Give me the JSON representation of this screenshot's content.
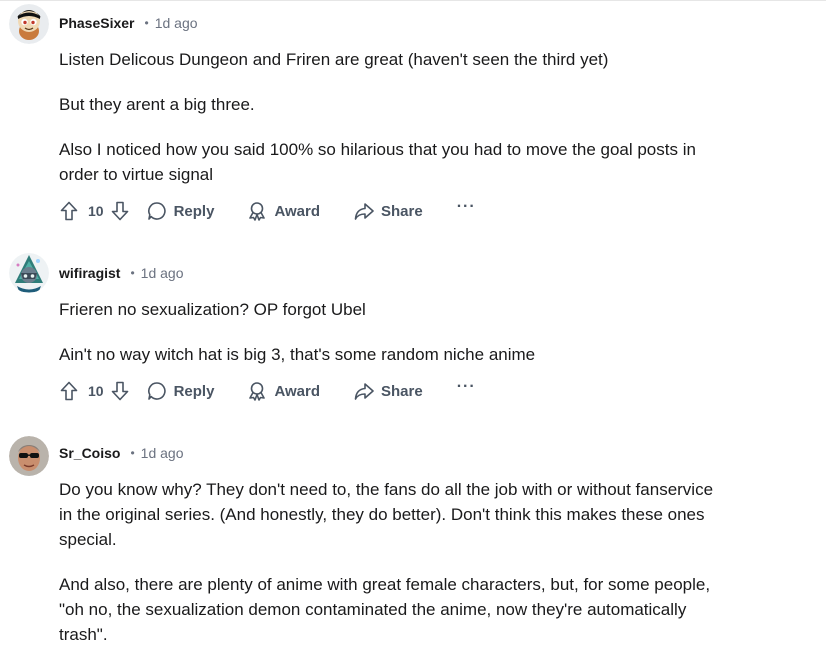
{
  "comments": [
    {
      "username": "PhaseSixer",
      "separator": "•",
      "time": "1d ago",
      "paragraphs": [
        "Listen Delicous Dungeon and Friren are great (haven't seen the third yet)",
        "But they arent a big three.",
        "Also I noticed how you said 100% so hilarious that you had to move the goal posts in\norder to virtue signal"
      ],
      "score": "10",
      "reply_label": "Reply",
      "award_label": "Award",
      "share_label": "Share",
      "more_label": "···"
    },
    {
      "username": "wifiragist",
      "separator": "•",
      "time": "1d ago",
      "paragraphs": [
        "Frieren no sexualization? OP forgot Ubel",
        "Ain't no way witch hat is big 3, that's some random niche anime"
      ],
      "score": "10",
      "reply_label": "Reply",
      "award_label": "Award",
      "share_label": "Share",
      "more_label": "···"
    },
    {
      "username": "Sr_Coiso",
      "separator": "•",
      "time": "1d ago",
      "paragraphs": [
        "Do you know why? They don't need to, the fans do all the job with or without fanservice\nin the original series. (And honestly, they do better). Don't think this makes these ones\nspecial.",
        "And also, there are plenty of anime with great female characters, but, for some people,\n\"oh no, the sexualization demon contaminated the anime, now they're automatically\ntrash\"."
      ]
    }
  ],
  "colors": {
    "text": "#1a1a1b",
    "muted": "#6b7280",
    "action": "#4a5563"
  },
  "icons": {
    "upvote": "arrow-up-outline-icon",
    "downvote": "arrow-down-outline-icon",
    "reply": "speech-bubble-icon",
    "award": "award-ribbon-icon",
    "share": "share-arrow-icon",
    "more": "ellipsis-icon"
  }
}
